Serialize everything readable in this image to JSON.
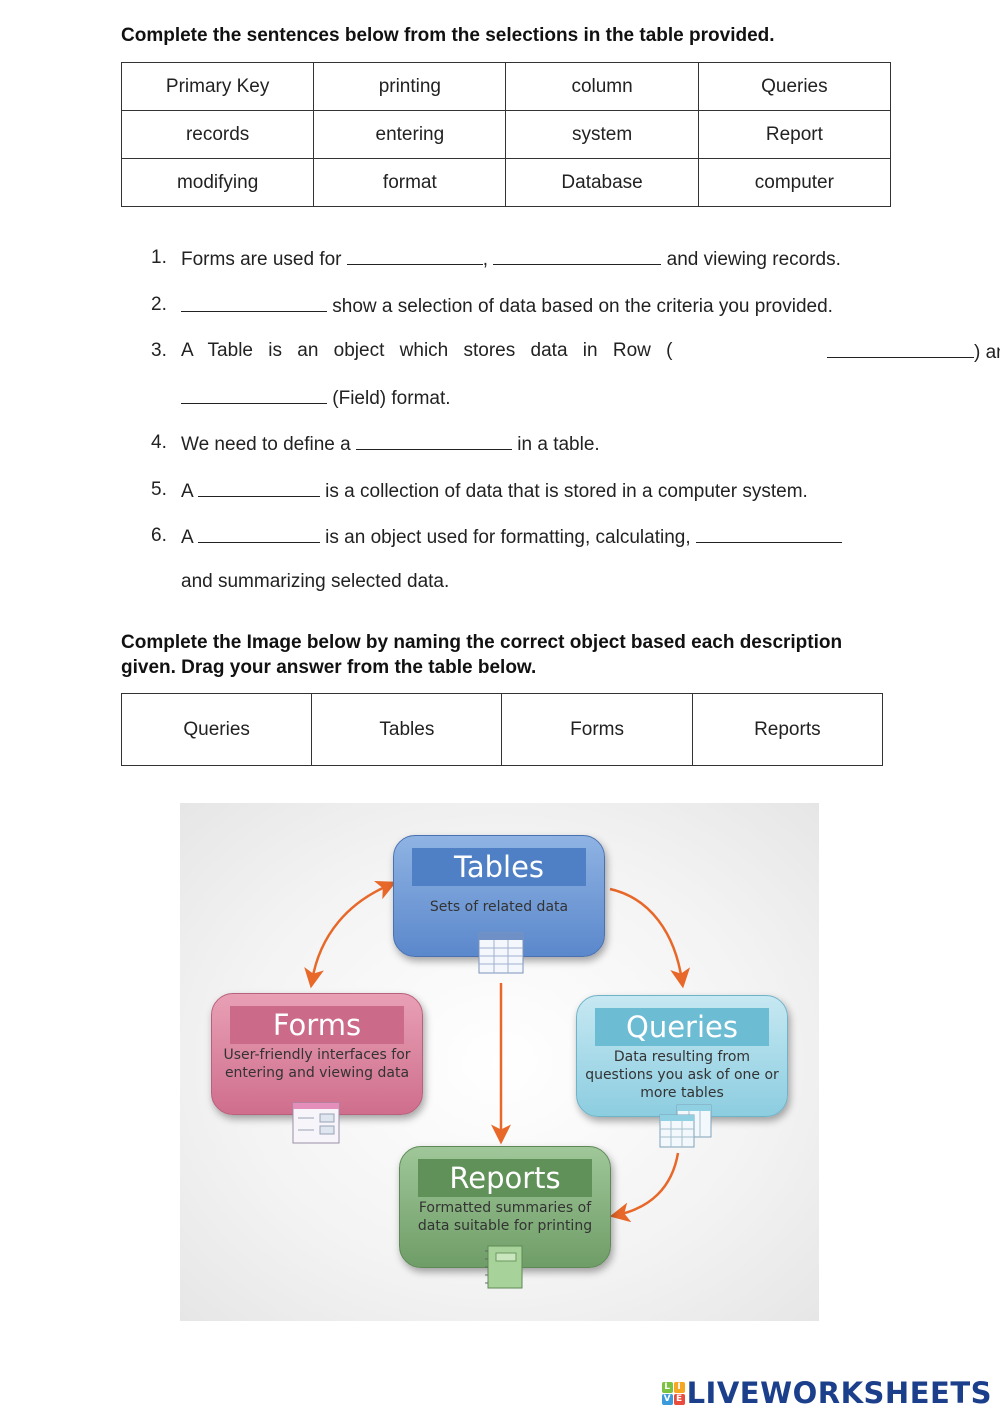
{
  "section1": {
    "instruction": "Complete the sentences below from the selections in the table provided.",
    "word_bank": [
      [
        "Primary Key",
        "printing",
        "column",
        "Queries"
      ],
      [
        "records",
        "entering",
        "system",
        "Report"
      ],
      [
        "modifying",
        "format",
        "Database",
        "computer"
      ]
    ],
    "questions": [
      {
        "num": "1.",
        "parts": [
          "Forms are used for ",
          ", ",
          " and viewing records."
        ]
      },
      {
        "num": "2.",
        "parts": [
          "",
          " show a selection of data based on the criteria you provided."
        ]
      },
      {
        "num": "3.",
        "line1": [
          "A Table is an object which stores data in Row (",
          ") and"
        ],
        "line2": [
          "",
          " (Field) format."
        ]
      },
      {
        "num": "4.",
        "parts": [
          "We need to define a ",
          " in a table."
        ]
      },
      {
        "num": "5.",
        "parts": [
          "A ",
          " is a collection of data that is stored in a computer system."
        ]
      },
      {
        "num": "6.",
        "line1": [
          "A ",
          " is an object used for formatting, calculating, ",
          ""
        ],
        "line2": [
          "and summarizing selected data."
        ]
      }
    ]
  },
  "section2": {
    "instruction": "Complete the Image below by naming the correct object based each description given. Drag your answer from the table below.",
    "answer_bank": [
      "Queries",
      "Tables",
      "Forms",
      "Reports"
    ]
  },
  "diagram": {
    "nodes": {
      "tables": {
        "title": "Tables",
        "desc": "Sets of related data",
        "color": "#5b88cc"
      },
      "forms": {
        "title": "Forms",
        "desc": "User-friendly interfaces for entering and viewing data",
        "color": "#cf6e8d"
      },
      "queries": {
        "title": "Queries",
        "desc": "Data resulting from questions you ask of one or more tables",
        "color": "#8ccde0"
      },
      "reports": {
        "title": "Reports",
        "desc": "Formatted summaries of data suitable for printing",
        "color": "#6f9d67"
      }
    },
    "arrow_color": "#e8682a"
  },
  "branding": {
    "logo_letters": [
      "L",
      "I",
      "V",
      "E"
    ],
    "logo_colors": [
      "#7cc242",
      "#f5a623",
      "#3b9ad9",
      "#e94b3c"
    ],
    "name": "LIVEWORKSHEETS"
  }
}
